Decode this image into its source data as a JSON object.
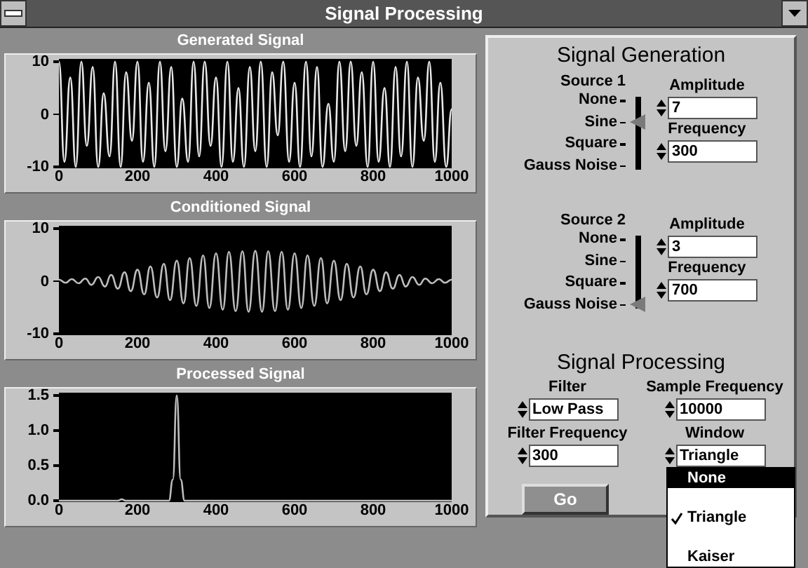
{
  "window": {
    "title": "Signal Processing"
  },
  "graphs": [
    {
      "kind": "chart",
      "chart_data": {
        "type": "line",
        "title": "Generated Signal",
        "x": [
          0,
          14,
          29,
          43,
          57,
          71,
          86,
          100,
          114,
          129,
          143,
          157,
          171,
          186,
          200,
          214,
          229,
          243,
          257,
          271,
          286,
          300,
          314,
          329,
          343,
          357,
          371,
          386,
          400,
          414,
          429,
          443,
          457,
          471,
          486,
          500,
          514,
          529,
          543,
          557,
          571,
          586,
          600,
          614,
          629,
          643,
          657,
          671,
          686,
          700,
          714,
          729,
          743,
          757,
          771,
          786,
          800,
          814,
          829,
          843,
          857,
          871,
          886,
          900,
          914,
          929,
          943,
          957,
          971,
          986,
          1000
        ],
        "series": [
          {
            "color": "#e8e8e8",
            "values": [
              10,
              -9,
              7,
              -10,
              10,
              -6,
              9,
              -10,
              4,
              -8,
              10,
              -10,
              8,
              -5,
              10,
              -9,
              6,
              -10,
              10,
              -7,
              9,
              -10,
              3,
              -9,
              10,
              -8,
              10,
              -6,
              7,
              -10,
              10,
              -9,
              5,
              -10,
              9,
              -7,
              10,
              -10,
              8,
              -4,
              10,
              -9,
              6,
              -10,
              10,
              -8,
              9,
              -10,
              2,
              -9,
              10,
              -7,
              10,
              -6,
              8,
              -10,
              10,
              -9,
              5,
              -10,
              9,
              -8,
              10,
              -10,
              7,
              -5,
              10,
              -9,
              6,
              -10,
              1
            ]
          }
        ],
        "xlim": [
          0,
          1000
        ],
        "ylim": [
          -10,
          10
        ],
        "xticks": [
          0,
          200,
          400,
          600,
          800,
          1000
        ],
        "yticks": [
          10,
          0,
          -10
        ]
      }
    },
    {
      "kind": "chart",
      "chart_data": {
        "type": "line",
        "title": "Conditioned Signal",
        "x": [
          0,
          17,
          33,
          50,
          67,
          83,
          100,
          117,
          133,
          150,
          167,
          183,
          200,
          217,
          233,
          250,
          267,
          283,
          300,
          317,
          333,
          350,
          367,
          383,
          400,
          417,
          433,
          450,
          467,
          483,
          500,
          517,
          533,
          550,
          567,
          583,
          600,
          617,
          633,
          650,
          667,
          683,
          700,
          717,
          733,
          750,
          767,
          783,
          800,
          817,
          833,
          850,
          867,
          883,
          900,
          917,
          933,
          950,
          967,
          983,
          1000
        ],
        "series": [
          {
            "color": "#bdbdbd",
            "values": [
              0.3,
              -0.3,
              0.4,
              -0.4,
              0.5,
              -0.7,
              0.8,
              -1.0,
              1.2,
              -1.4,
              1.7,
              -1.9,
              2.2,
              -2.5,
              2.8,
              -3.1,
              3.3,
              -3.6,
              3.9,
              -4.2,
              4.4,
              -4.7,
              4.9,
              -5.1,
              5.3,
              -5.4,
              5.6,
              -5.7,
              5.7,
              -5.8,
              5.8,
              -5.8,
              5.7,
              -5.7,
              5.6,
              -5.4,
              5.3,
              -5.1,
              4.9,
              -4.7,
              4.4,
              -4.2,
              3.9,
              -3.6,
              3.3,
              -3.1,
              2.8,
              -2.5,
              2.2,
              -1.9,
              1.7,
              -1.4,
              1.2,
              -1.0,
              0.8,
              -0.7,
              0.5,
              -0.4,
              0.4,
              -0.3,
              0.3
            ]
          }
        ],
        "xlim": [
          0,
          1000
        ],
        "ylim": [
          -10,
          10
        ],
        "xticks": [
          0,
          200,
          400,
          600,
          800,
          1000
        ],
        "yticks": [
          10,
          0,
          -10
        ]
      }
    },
    {
      "kind": "chart",
      "chart_data": {
        "type": "line",
        "title": "Processed Signal",
        "x": [
          0,
          150,
          160,
          170,
          280,
          290,
          300,
          310,
          320,
          1000
        ],
        "series": [
          {
            "color": "#bdbdbd",
            "values": [
              0,
              0,
              0.02,
              0,
              0,
              0.3,
              1.5,
              0.3,
              0,
              0
            ]
          }
        ],
        "xlim": [
          0,
          1000
        ],
        "ylim": [
          0,
          1.5
        ],
        "xticks": [
          0,
          200,
          400,
          600,
          800,
          1000
        ],
        "yticks": [
          {
            "value": 1.5,
            "label": "1.5"
          },
          {
            "value": 1,
            "label": "1.0"
          },
          {
            "value": 0.5,
            "label": "0.5"
          },
          {
            "value": 0,
            "label": "0.0"
          }
        ]
      }
    }
  ],
  "signal_generation": {
    "title": "Signal Generation",
    "sources": [
      {
        "label": "Source 1",
        "options": [
          {
            "label": "None",
            "selected": false
          },
          {
            "label": "Sine",
            "selected": true
          },
          {
            "label": "Square",
            "selected": false
          },
          {
            "label": "Gauss Noise",
            "selected": false
          }
        ],
        "amplitude_label": "Amplitude",
        "amplitude": "7",
        "frequency_label": "Frequency",
        "frequency": "300"
      },
      {
        "label": "Source 2",
        "options": [
          {
            "label": "None",
            "selected": false
          },
          {
            "label": "Sine",
            "selected": false
          },
          {
            "label": "Square",
            "selected": false
          },
          {
            "label": "Gauss Noise",
            "selected": true
          }
        ],
        "amplitude_label": "Amplitude",
        "amplitude": "3",
        "frequency_label": "Frequency",
        "frequency": "700"
      }
    ]
  },
  "signal_processing": {
    "title": "Signal Processing",
    "fields": [
      {
        "label": "Filter",
        "value": "Low Pass"
      },
      {
        "label": "Sample Frequency",
        "value": "10000"
      },
      {
        "label": "Filter Frequency",
        "value": "300"
      },
      {
        "label": "Window",
        "value": "Triangle"
      }
    ],
    "go_button": "Go"
  },
  "window_menu": {
    "items": [
      {
        "label": "None",
        "selected": true,
        "checked": false
      },
      {
        "label": "Triangle",
        "selected": false,
        "checked": true
      },
      {
        "label": "Kaiser",
        "selected": false,
        "checked": false
      }
    ]
  }
}
